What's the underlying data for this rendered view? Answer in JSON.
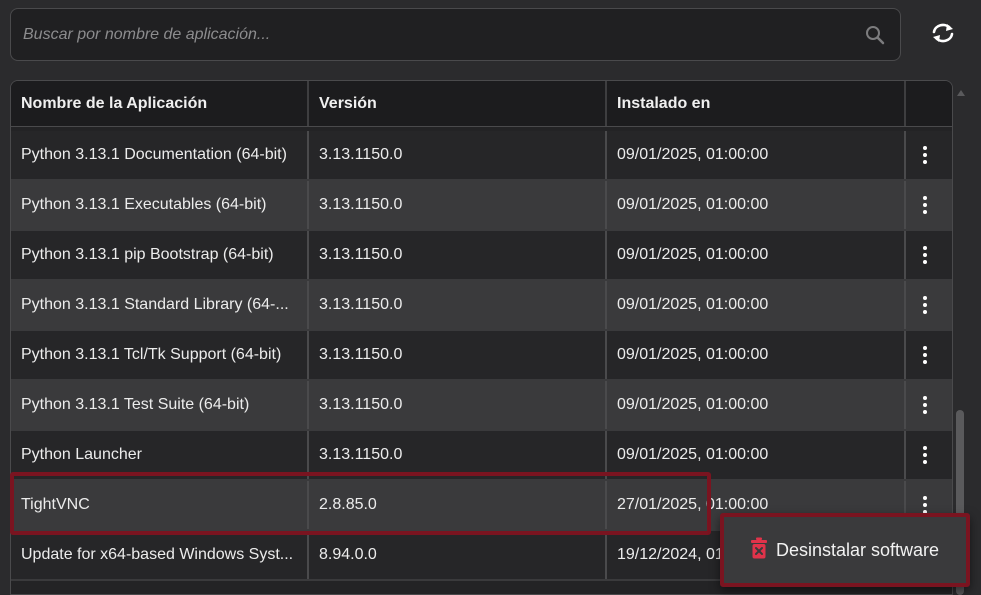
{
  "search": {
    "placeholder": "Buscar por nombre de aplicación..."
  },
  "icons": {
    "search": "search-icon",
    "refresh": "refresh-icon",
    "more": "more-vertical-icon",
    "delete": "trash-icon"
  },
  "colors": {
    "background": "#2b2b2d",
    "row_odd": "#262628",
    "row_even": "#3a3a3c",
    "highlight": "#7a1420",
    "delete_icon": "#e0334a"
  },
  "table": {
    "headers": [
      "Nombre de la Aplicación",
      "Versión",
      "Instalado en",
      ""
    ],
    "rows": [
      {
        "name": "Python 3.13.1 Documentation (64-bit)",
        "version": "3.13.1150.0",
        "installed": "09/01/2025, 01:00:00"
      },
      {
        "name": "Python 3.13.1 Executables (64-bit)",
        "version": "3.13.1150.0",
        "installed": "09/01/2025, 01:00:00"
      },
      {
        "name": "Python 3.13.1 pip Bootstrap (64-bit)",
        "version": "3.13.1150.0",
        "installed": "09/01/2025, 01:00:00"
      },
      {
        "name": "Python 3.13.1 Standard Library (64-...",
        "version": "3.13.1150.0",
        "installed": "09/01/2025, 01:00:00"
      },
      {
        "name": "Python 3.13.1 Tcl/Tk Support (64-bit)",
        "version": "3.13.1150.0",
        "installed": "09/01/2025, 01:00:00"
      },
      {
        "name": "Python 3.13.1 Test Suite (64-bit)",
        "version": "3.13.1150.0",
        "installed": "09/01/2025, 01:00:00"
      },
      {
        "name": "Python Launcher",
        "version": "3.13.1150.0",
        "installed": "09/01/2025, 01:00:00"
      },
      {
        "name": "TightVNC",
        "version": "2.8.85.0",
        "installed": "27/01/2025, 01:00:00"
      },
      {
        "name": "Update for x64-based Windows Syst...",
        "version": "8.94.0.0",
        "installed": "19/12/2024, 01:00:00"
      }
    ]
  },
  "context_menu": {
    "uninstall_label": "Desinstalar software"
  }
}
